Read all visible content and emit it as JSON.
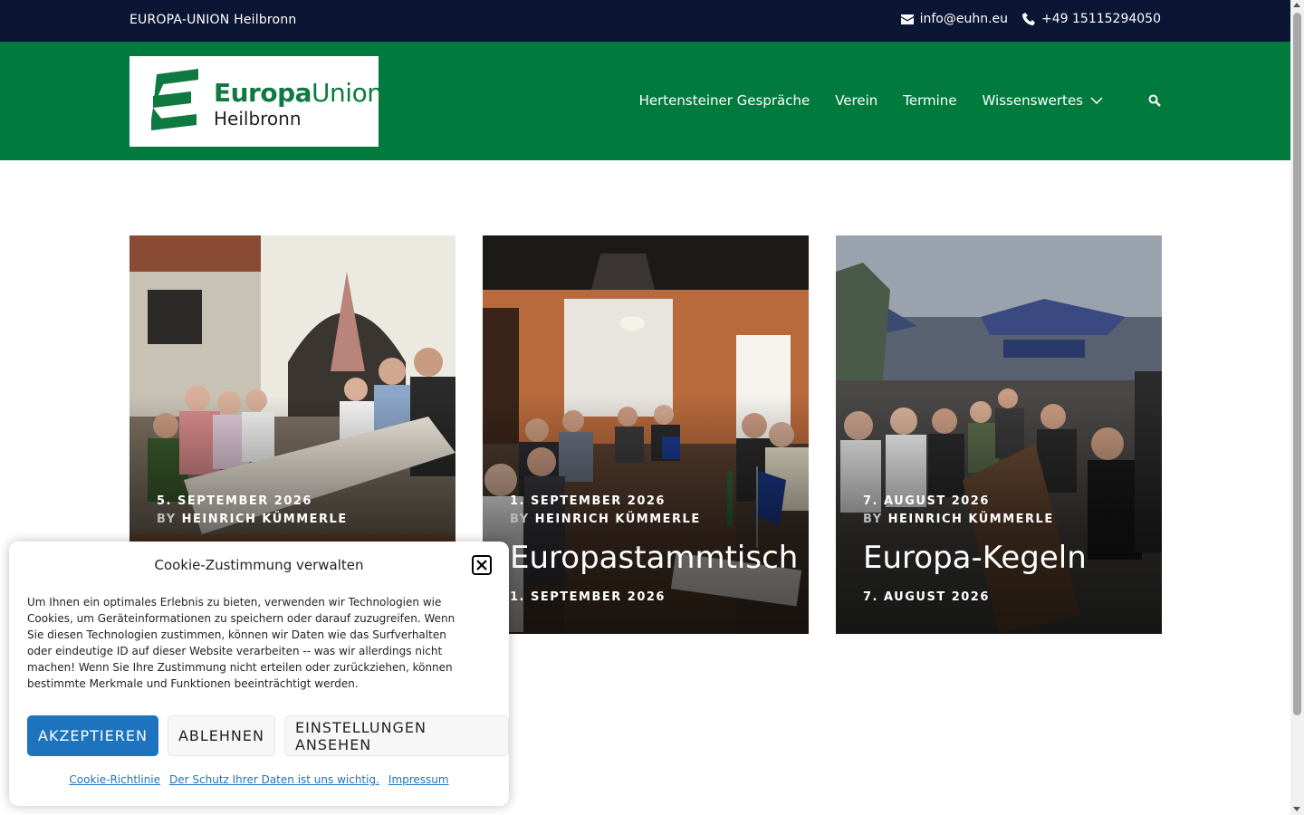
{
  "topbar": {
    "site_name": "EUROPA-UNION Heilbronn",
    "email": "info@euhn.eu",
    "phone": "+49 15115294050"
  },
  "logo": {
    "brand_bold": "Europa",
    "brand_regular": "Union",
    "city": "Heilbronn"
  },
  "nav": {
    "items": [
      {
        "label": "Hertensteiner Gespräche"
      },
      {
        "label": "Verein"
      },
      {
        "label": "Termine"
      },
      {
        "label": "Wissenswertes"
      }
    ]
  },
  "posts": [
    {
      "date": "5. SEPTEMBER 2026",
      "by": "BY",
      "author": "HEINRICH KÜMMERLE",
      "title": "",
      "date_bottom": ""
    },
    {
      "date": "1. SEPTEMBER 2026",
      "by": "BY",
      "author": "HEINRICH KÜMMERLE",
      "title": "Europastammtisch",
      "date_bottom": "1. SEPTEMBER 2026"
    },
    {
      "date": "7. AUGUST 2026",
      "by": "BY",
      "author": "HEINRICH KÜMMERLE",
      "title": "Europa-Kegeln",
      "date_bottom": "7. AUGUST 2026"
    }
  ],
  "cookie": {
    "title": "Cookie-Zustimmung verwalten",
    "text": "Um Ihnen ein optimales Erlebnis zu bieten, verwenden wir Technologien wie Cookies, um Geräteinformationen zu speichern oder darauf zuzugreifen. Wenn Sie diesen Technologien zustimmen, können wir Daten wie das Surfverhalten oder eindeutige ID auf dieser Website verarbeiten -- was wir allerdings nicht machen! Wenn Sie Ihre Zustimmung nicht erteilen oder zurückziehen, können bestimmte Merkmale und Funktionen beeinträchtigt werden.",
    "accept_label": "AKZEPTIEREN",
    "decline_label": "ABLEHNEN",
    "settings_label": "EINSTELLUNGEN ANSEHEN",
    "link_policy": "Cookie-Richtlinie",
    "link_privacy": "Der Schutz Ihrer Daten ist uns wichtig.",
    "link_imprint": "Impressum"
  },
  "colors": {
    "topbar_bg": "#0b1634",
    "header_bg": "#007a3d",
    "accent_button": "#1e73be"
  }
}
